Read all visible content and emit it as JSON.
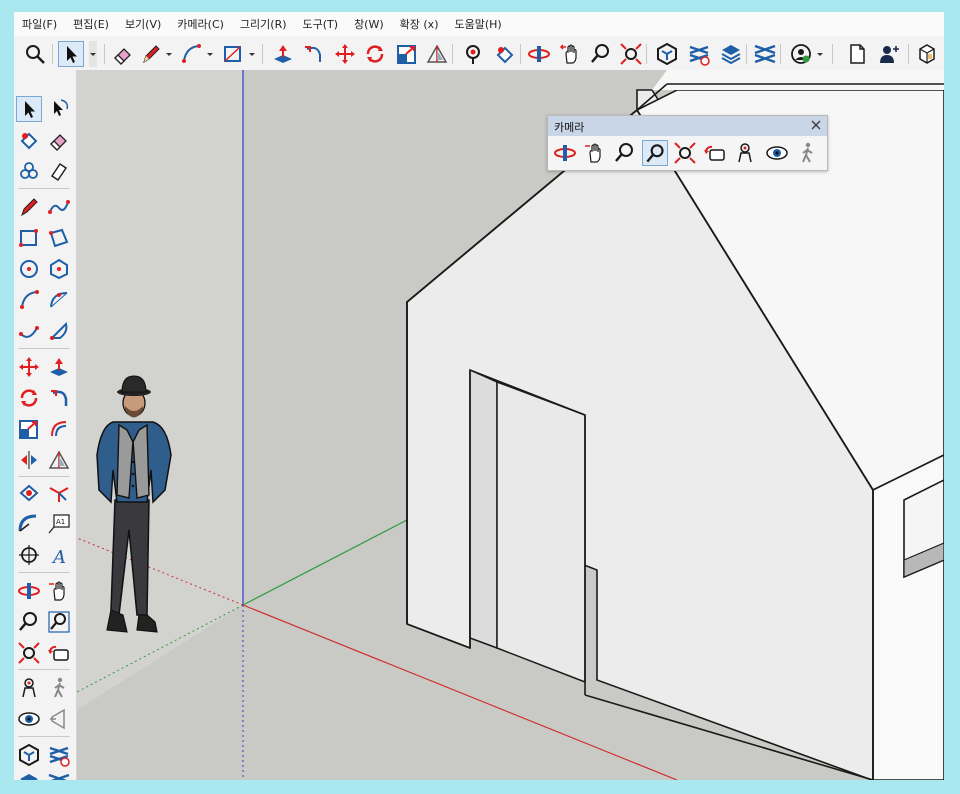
{
  "menubar": {
    "items": [
      "파일(F)",
      "편집(E)",
      "보기(V)",
      "카메라(C)",
      "그리기(R)",
      "도구(T)",
      "창(W)",
      "확장 (x)",
      "도움말(H)"
    ]
  },
  "camera_panel": {
    "title": "카메라",
    "close_glyph": "✕"
  },
  "colors": {
    "accent_red": "#e02020",
    "accent_blue": "#1f5fa8",
    "selection_bg": "#dceaf7",
    "axis_red": "#d03030",
    "axis_green": "#2f9b3f",
    "axis_blue": "#3a3ad0",
    "ground": "#c9c9c5",
    "wall": "#f2f2f2"
  },
  "icons": {
    "top_toolbar": [
      "zoom-icon",
      "select-arrow-icon",
      "eraser-icon",
      "pencil-icon",
      "arc-icon",
      "rectangle-icon",
      "push-pull-icon",
      "follow-me-icon",
      "move-icon",
      "rotate-icon",
      "scale-icon",
      "tape-measure-icon",
      "paint-bucket-icon",
      "rotate-orbit-icon",
      "pan-icon",
      "zoom-window-icon",
      "zoom-extents-icon",
      "3d-warehouse-icon",
      "extension-warehouse-icon",
      "layers-icon",
      "sandbox-icon",
      "account-icon",
      "new-document-icon",
      "add-user-icon",
      "model-info-icon"
    ],
    "camera_panel": [
      "orbit-icon",
      "pan-icon",
      "zoom-icon",
      "zoom-window-icon",
      "zoom-extents-icon",
      "previous-view-icon",
      "position-camera-icon",
      "look-around-icon",
      "walk-icon"
    ]
  }
}
